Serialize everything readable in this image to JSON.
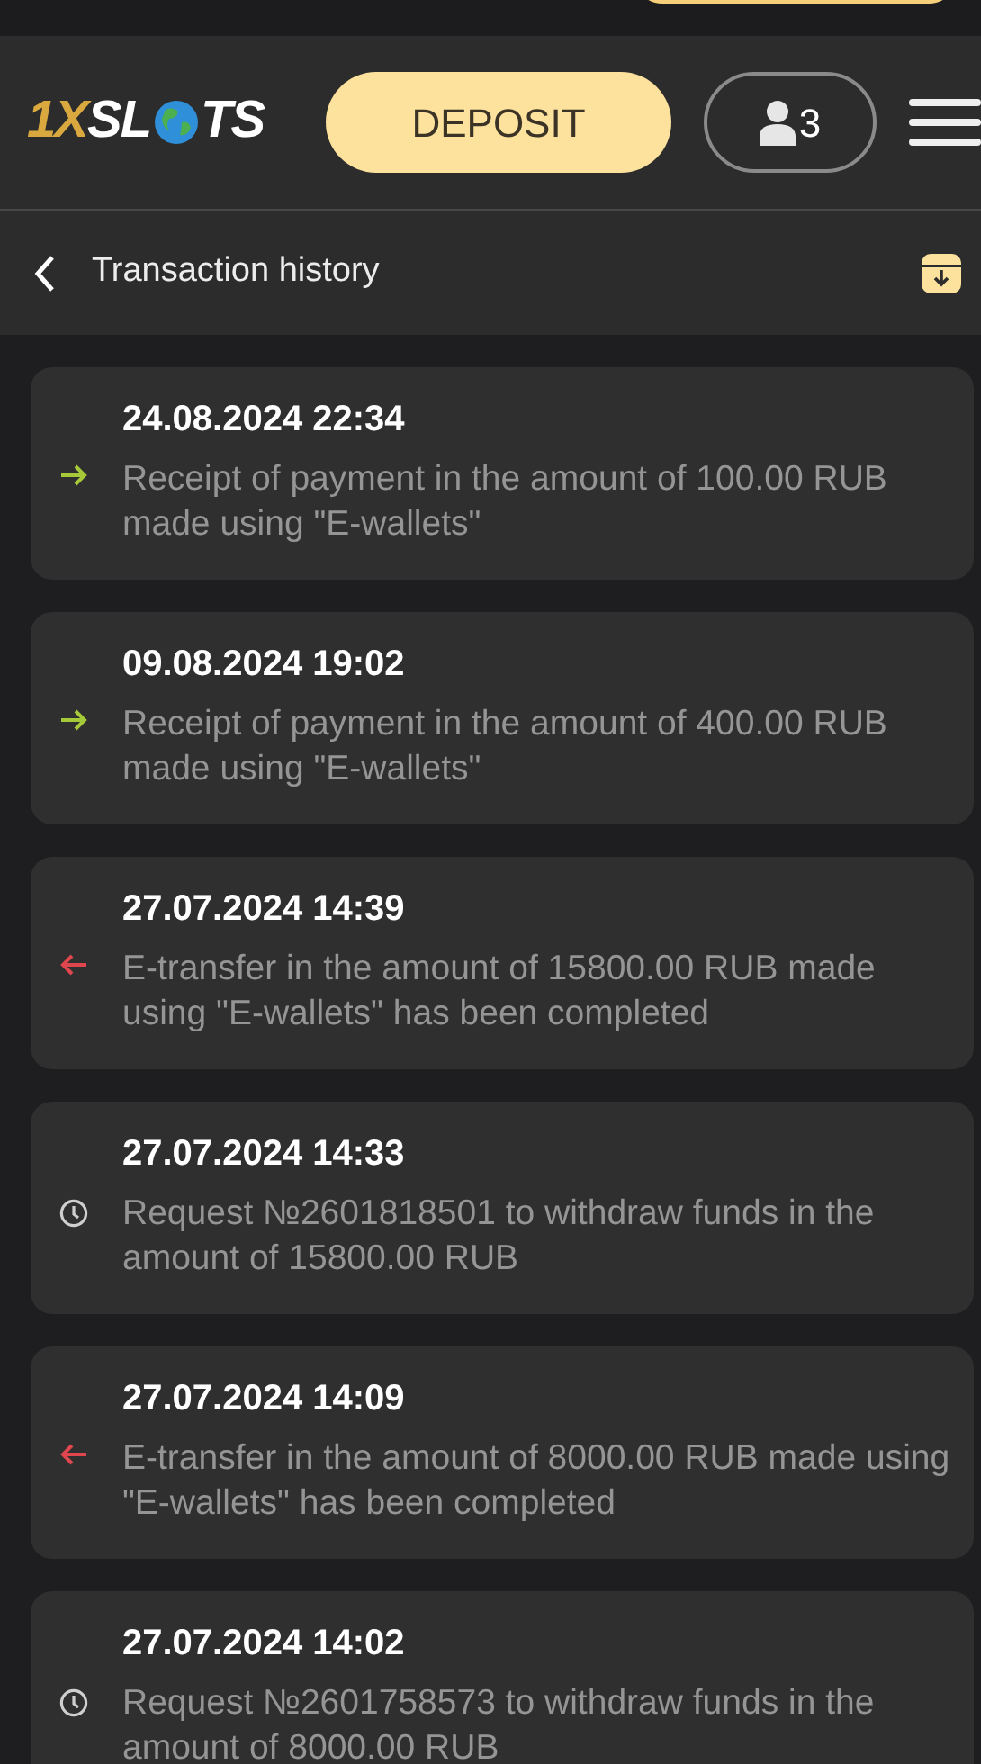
{
  "header": {
    "logo": {
      "lead": "1X",
      "middle": "SL",
      "end": "TS"
    },
    "deposit_button": "DEPOSIT",
    "account_count": "3"
  },
  "subheader": {
    "title": "Transaction history"
  },
  "transactions": [
    {
      "kind": "incoming",
      "date": "24.08.2024 22:34",
      "text": "Receipt of payment in the amount of 100.00 RUB made using \"E-wallets\""
    },
    {
      "kind": "incoming",
      "date": "09.08.2024 19:02",
      "text": "Receipt of payment in the amount of 400.00 RUB made using \"E-wallets\""
    },
    {
      "kind": "outgoing",
      "date": "27.07.2024 14:39",
      "text": "E-transfer in the amount of 15800.00 RUB made using \"E-wallets\" has been completed"
    },
    {
      "kind": "pending",
      "date": "27.07.2024 14:33",
      "text": "Request №2601818501 to withdraw funds in the amount of 15800.00 RUB"
    },
    {
      "kind": "outgoing",
      "date": "27.07.2024 14:09",
      "text": "E-transfer in the amount of 8000.00 RUB made using \"E-wallets\" has been completed"
    },
    {
      "kind": "pending",
      "date": "27.07.2024 14:02",
      "text": "Request №2601758573 to withdraw funds in the amount of 8000.00 RUB"
    }
  ]
}
